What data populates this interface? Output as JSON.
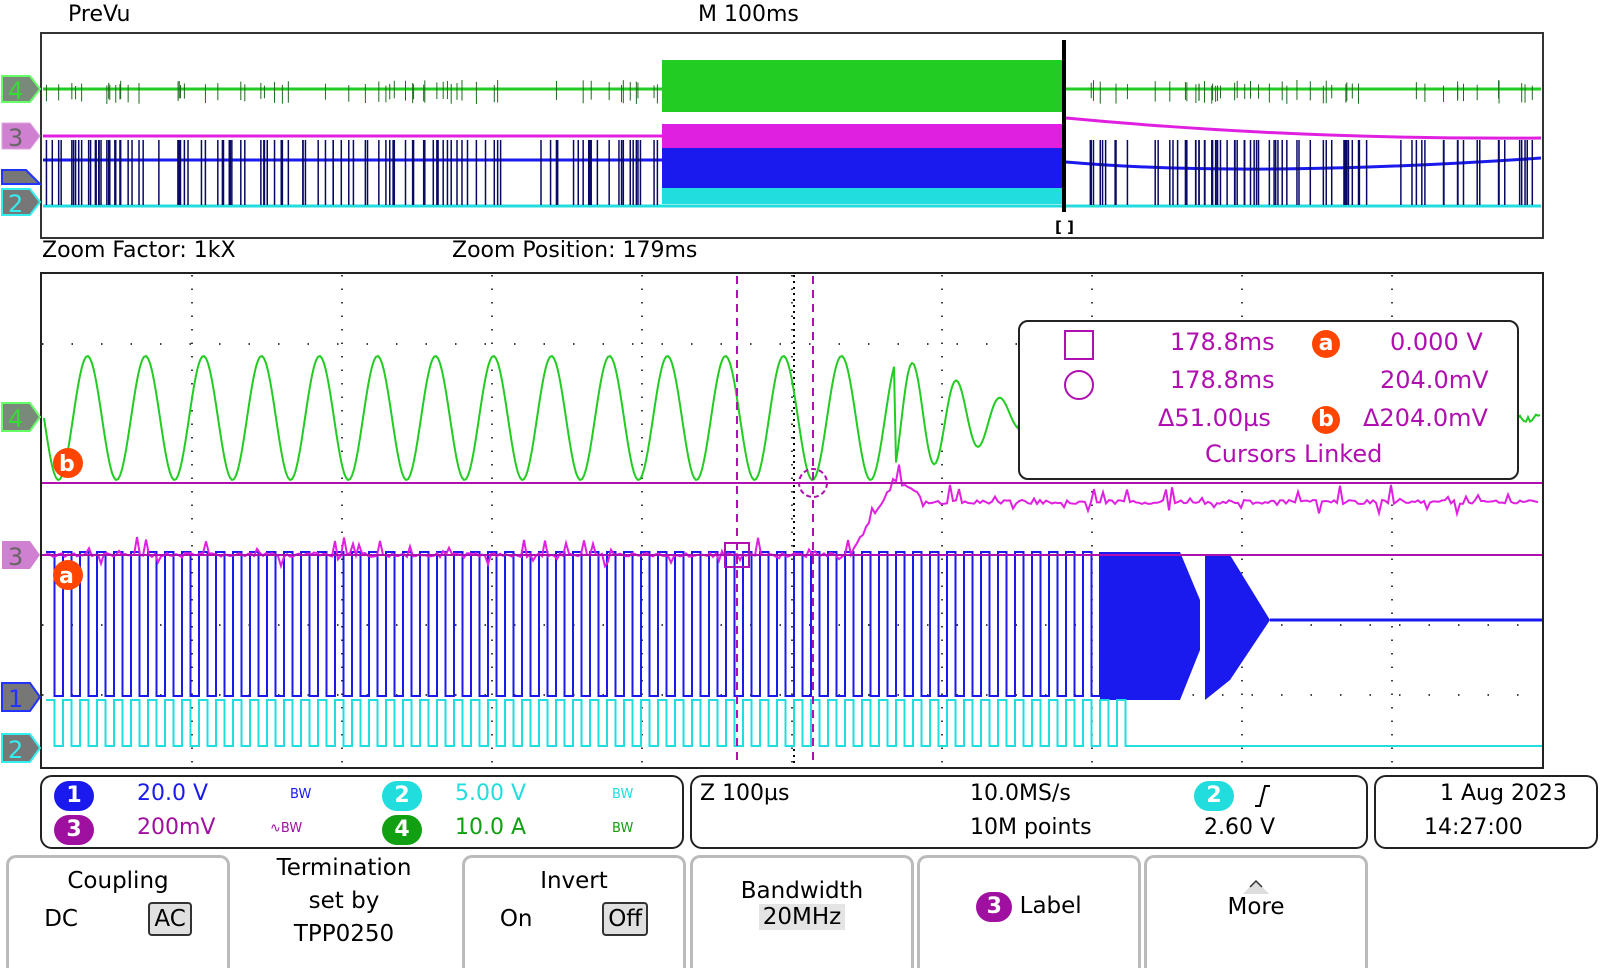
{
  "prevu": {
    "title": "PreVu",
    "timebase": "M 100ms",
    "zoom_marker": "[ ]"
  },
  "zoom_info": {
    "factor_label": "Zoom Factor: 1kX",
    "position_label": "Zoom Position: 179ms"
  },
  "channel_markers": [
    "4",
    "3",
    "1",
    "2"
  ],
  "cursor_markers": {
    "a": "a",
    "b": "b"
  },
  "cursor_readout": {
    "row1": {
      "time": "178.8ms",
      "marker": "a",
      "value": "0.000 V"
    },
    "row2": {
      "time": "178.8ms",
      "value": "204.0mV"
    },
    "row3": {
      "delta_time": "Δ51.00µs",
      "marker": "b",
      "delta_value": "Δ204.0mV"
    },
    "status": "Cursors Linked"
  },
  "channels": [
    {
      "num": "1",
      "scale": "20.0 V",
      "bw": "BW",
      "color": "#1a1aee"
    },
    {
      "num": "2",
      "scale": "5.00 V",
      "bw": "BW",
      "color": "#22dddd"
    },
    {
      "num": "3",
      "scale": "200mV",
      "bw": "∿BW",
      "color": "#a010a0"
    },
    {
      "num": "4",
      "scale": "10.0 A",
      "bw": "BW",
      "color": "#11a011"
    }
  ],
  "acquisition": {
    "zoom_scale": "Z 100µs",
    "sample_rate": "10.0MS/s",
    "record_length": "10M points",
    "trigger_channel": "2",
    "trigger_slope": "rising-edge",
    "trigger_level": "2.60 V"
  },
  "datetime": {
    "date": "1 Aug 2023",
    "time": "14:27:00"
  },
  "softkeys": {
    "coupling": {
      "label": "Coupling",
      "options": [
        "DC",
        "AC"
      ],
      "selected": "AC"
    },
    "termination": {
      "line1": "Termination",
      "line2": "set by",
      "line3": "TPP0250"
    },
    "invert": {
      "label": "Invert",
      "options": [
        "On",
        "Off"
      ],
      "selected": "Off"
    },
    "bandwidth": {
      "label": "Bandwidth",
      "value": "20MHz"
    },
    "label": {
      "channel": "3",
      "text": "Label"
    },
    "more": {
      "text": "More"
    }
  },
  "colors": {
    "ch1": "#1a1aee",
    "ch2": "#22dddd",
    "ch3": "#e020e0",
    "ch4": "#22cc22",
    "cursor": "#b010b0",
    "trigger_marker": "#ff9900",
    "cursor_marker": "#ff4500"
  }
}
